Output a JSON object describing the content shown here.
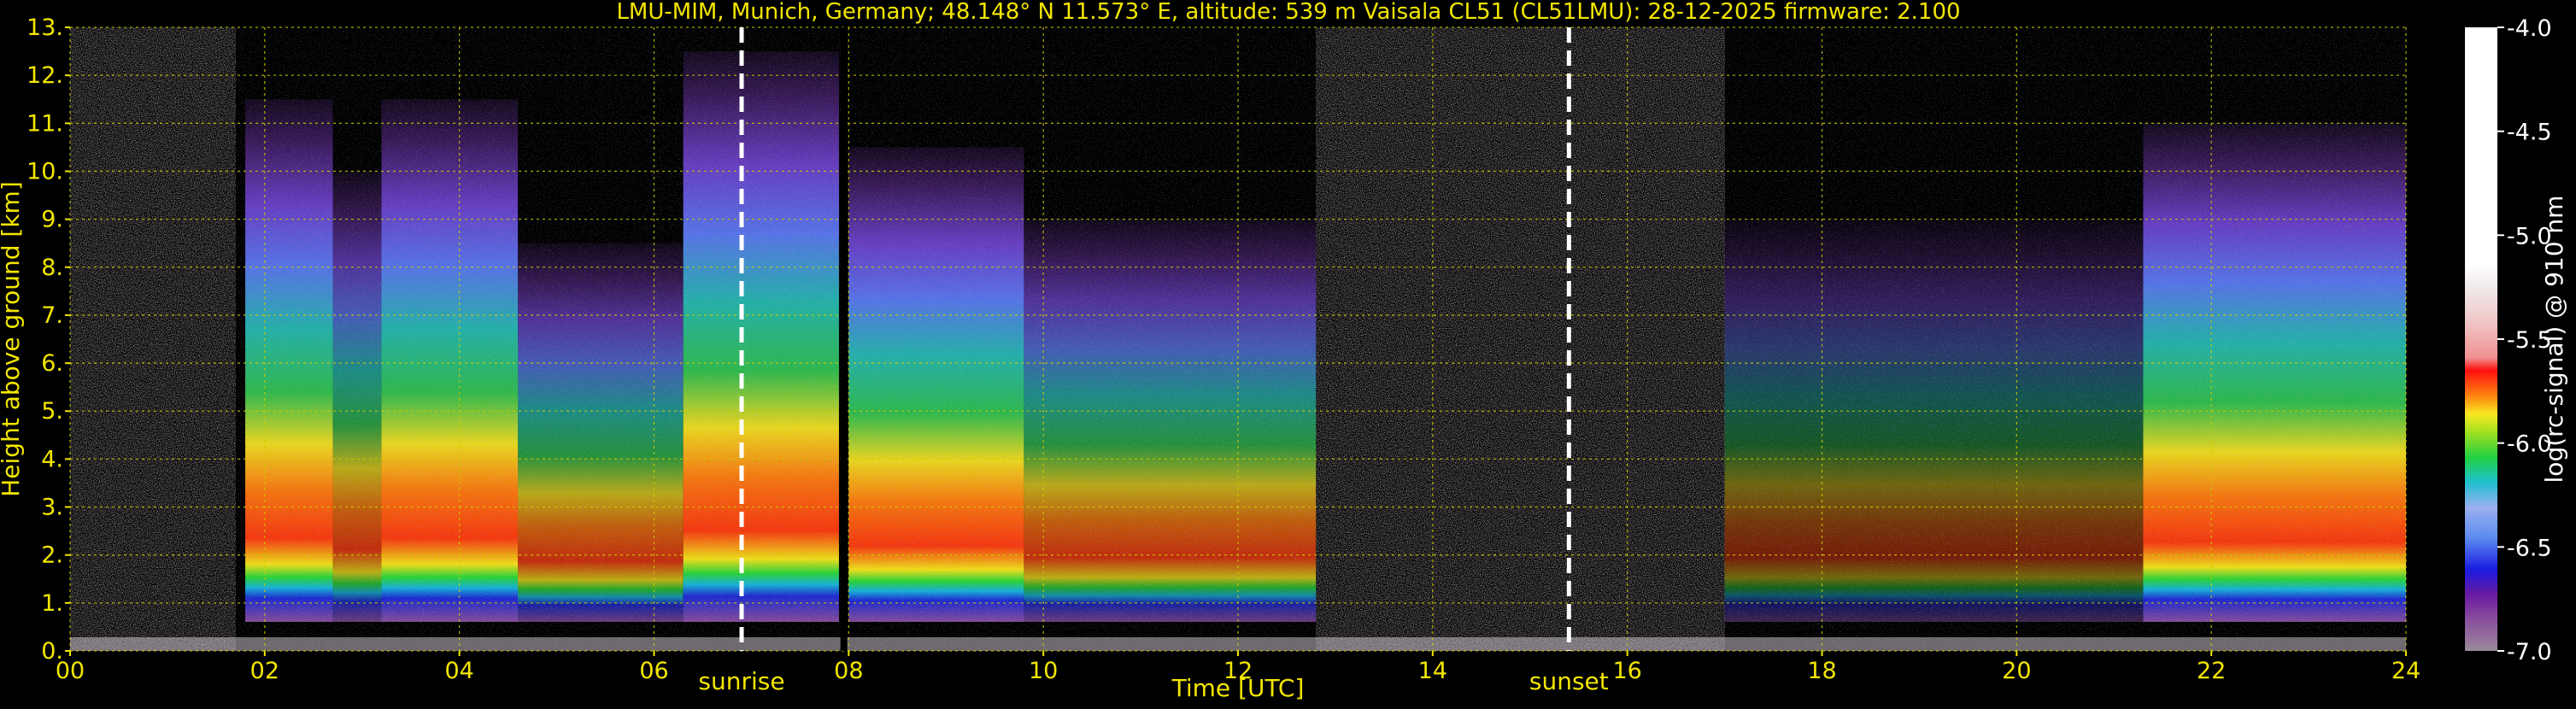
{
  "chart_data": {
    "type": "heatmap",
    "title": "LMU-MIM, Munich, Germany; 48.148° N 11.573° E, altitude: 539 m    Vaisala CL51 (CL51LMU): 28-12-2025    firmware: 2.100",
    "xlabel": "Time [UTC]",
    "ylabel": "Height above ground [km]",
    "xlim": [
      0,
      24
    ],
    "ylim": [
      0,
      13
    ],
    "x_ticks": [
      "00",
      "02",
      "04",
      "06",
      "08",
      "10",
      "12",
      "14",
      "16",
      "18",
      "20",
      "22",
      "24"
    ],
    "y_ticks": [
      "0.",
      "1.",
      "2.",
      "3.",
      "4.",
      "5.",
      "6.",
      "7.",
      "8.",
      "9.",
      "10.",
      "11.",
      "12.",
      "13."
    ],
    "grid": true,
    "annotations": [
      {
        "label": "sunrise",
        "x": 6.9
      },
      {
        "label": "sunset",
        "x": 15.4
      }
    ],
    "data_gap_x": 7.95,
    "colorbar": {
      "label": "log(rc-signal) @ 910 nm",
      "range": [
        -7.0,
        -4.0
      ],
      "ticks": [
        "-4.0",
        "-4.5",
        "-5.0",
        "-5.5",
        "-6.0",
        "-6.5",
        "-7.0"
      ]
    },
    "signal_columns": [
      {
        "x0": 0.0,
        "x1": 1.7,
        "top": 13.0,
        "kind": "noise"
      },
      {
        "x0": 1.8,
        "x1": 2.7,
        "top": 11.5,
        "kind": "strong"
      },
      {
        "x0": 2.7,
        "x1": 3.2,
        "top": 10.0,
        "kind": "medium"
      },
      {
        "x0": 3.2,
        "x1": 4.6,
        "top": 11.5,
        "kind": "strong"
      },
      {
        "x0": 4.6,
        "x1": 6.3,
        "top": 8.5,
        "kind": "medium"
      },
      {
        "x0": 6.3,
        "x1": 7.9,
        "top": 12.5,
        "kind": "strong"
      },
      {
        "x0": 8.0,
        "x1": 9.8,
        "top": 10.5,
        "kind": "strong"
      },
      {
        "x0": 9.8,
        "x1": 12.8,
        "top": 9.0,
        "kind": "medium"
      },
      {
        "x0": 12.8,
        "x1": 17.0,
        "top": 13.0,
        "kind": "noise"
      },
      {
        "x0": 17.0,
        "x1": 21.3,
        "top": 9.0,
        "kind": "weak"
      },
      {
        "x0": 21.3,
        "x1": 24.0,
        "top": 11.0,
        "kind": "strong"
      }
    ],
    "colors": {
      "axis_text": "#f3e600",
      "grid": "#cccc00",
      "marker_line": "#ffffff",
      "background": "#000000"
    }
  }
}
